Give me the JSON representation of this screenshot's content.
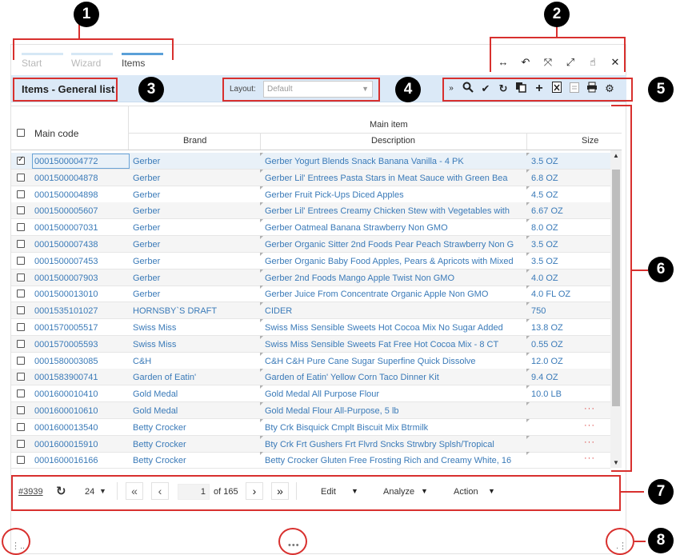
{
  "callouts": [
    "1",
    "2",
    "3",
    "4",
    "5",
    "6",
    "7",
    "8"
  ],
  "tabs": [
    {
      "label": "Start",
      "active": false
    },
    {
      "label": "Wizard",
      "active": false
    },
    {
      "label": "Items",
      "active": true
    }
  ],
  "window_icons": [
    "resize-horizontal-icon",
    "undo-icon",
    "fullscreen-icon",
    "expand-icon",
    "pointer-icon",
    "close-icon"
  ],
  "header": {
    "title": "Items - General list",
    "layout_label": "Layout:",
    "layout_value": "Default"
  },
  "toolbar_icons": [
    "double-chevron-down-icon",
    "search-icon",
    "check-icon",
    "refresh-icon",
    "copy-icon",
    "add-icon",
    "excel-export-icon",
    "paste-icon",
    "print-icon",
    "settings-icon"
  ],
  "grid": {
    "columns": {
      "main_code": "Main code",
      "group": "Main item",
      "brand": "Brand",
      "description": "Description",
      "size": "Size"
    },
    "rows": [
      {
        "code": "0001500004772",
        "brand": "Gerber",
        "description": "Gerber Yogurt Blends Snack Banana Vanilla - 4 PK",
        "size": "3.5 OZ",
        "checked": true
      },
      {
        "code": "0001500004878",
        "brand": "Gerber",
        "description": "Gerber Lil' Entrees Pasta Stars in Meat Sauce with Green Bea",
        "size": "6.8 OZ",
        "checked": false
      },
      {
        "code": "0001500004898",
        "brand": "Gerber",
        "description": "Gerber Fruit Pick-Ups Diced Apples",
        "size": "4.5 OZ",
        "checked": false
      },
      {
        "code": "0001500005607",
        "brand": "Gerber",
        "description": "Gerber Lil' Entrees Creamy Chicken Stew with Vegetables with",
        "size": "6.67 OZ",
        "checked": false
      },
      {
        "code": "0001500007031",
        "brand": "Gerber",
        "description": "Gerber Oatmeal Banana Strawberry Non GMO",
        "size": "8.0 OZ",
        "checked": false
      },
      {
        "code": "0001500007438",
        "brand": "Gerber",
        "description": "Gerber Organic Sitter 2nd Foods Pear Peach Strawberry Non G",
        "size": "3.5 OZ",
        "checked": false
      },
      {
        "code": "0001500007453",
        "brand": "Gerber",
        "description": "Gerber Organic Baby Food Apples, Pears & Apricots with Mixed",
        "size": "3.5 OZ",
        "checked": false
      },
      {
        "code": "0001500007903",
        "brand": "Gerber",
        "description": "Gerber 2nd Foods Mango Apple Twist Non GMO",
        "size": "4.0 OZ",
        "checked": false
      },
      {
        "code": "0001500013010",
        "brand": "Gerber",
        "description": "Gerber Juice From Concentrate Organic Apple Non GMO",
        "size": "4.0 FL OZ",
        "checked": false
      },
      {
        "code": "0001535101027",
        "brand": "HORNSBY`S DRAFT",
        "description": "CIDER",
        "size": "750",
        "checked": false
      },
      {
        "code": "0001570005517",
        "brand": "Swiss Miss",
        "description": "Swiss Miss Sensible Sweets Hot Cocoa Mix No Sugar Added",
        "size": "13.8 OZ",
        "checked": false
      },
      {
        "code": "0001570005593",
        "brand": "Swiss Miss",
        "description": "Swiss Miss Sensible Sweets Fat Free Hot Cocoa Mix - 8 CT",
        "size": "0.55 OZ",
        "checked": false
      },
      {
        "code": "0001580003085",
        "brand": "C&H",
        "description": "C&H C&H Pure Cane Sugar Superfine Quick Dissolve",
        "size": "12.0 OZ",
        "checked": false
      },
      {
        "code": "0001583900741",
        "brand": "Garden of Eatin'",
        "description": "Garden of Eatin' Yellow Corn Taco Dinner Kit",
        "size": "9.4 OZ",
        "checked": false
      },
      {
        "code": "0001600010410",
        "brand": "Gold Medal",
        "description": "Gold Medal All Purpose Flour",
        "size": "10.0 LB",
        "checked": false
      },
      {
        "code": "0001600010610",
        "brand": "Gold Medal",
        "description": "Gold Medal Flour All-Purpose, 5 lb",
        "size": "···",
        "checked": false
      },
      {
        "code": "0001600013540",
        "brand": "Betty Crocker",
        "description": "Bty Crk Bisquick Cmplt Biscuit Mix Btrmilk",
        "size": "···",
        "checked": false
      },
      {
        "code": "0001600015910",
        "brand": "Betty Crocker",
        "description": "Bty Crk Frt Gushers Frt Flvrd Sncks Strwbry Splsh/Tropical",
        "size": "···",
        "checked": false
      },
      {
        "code": "0001600016166",
        "brand": "Betty Crocker",
        "description": "Betty Crocker Gluten Free Frosting Rich and Creamy White, 16",
        "size": "···",
        "checked": false
      }
    ]
  },
  "footer": {
    "record": "#3939",
    "page_size": "24",
    "current_page": "1",
    "of_pages": "of 165",
    "menus": [
      "Edit",
      "Analyze",
      "Action"
    ]
  },
  "colors": {
    "accent": "#5aa0d8",
    "annotation": "#d8302e",
    "header_band": "#dbe9f7",
    "link": "#3a7ab8"
  }
}
